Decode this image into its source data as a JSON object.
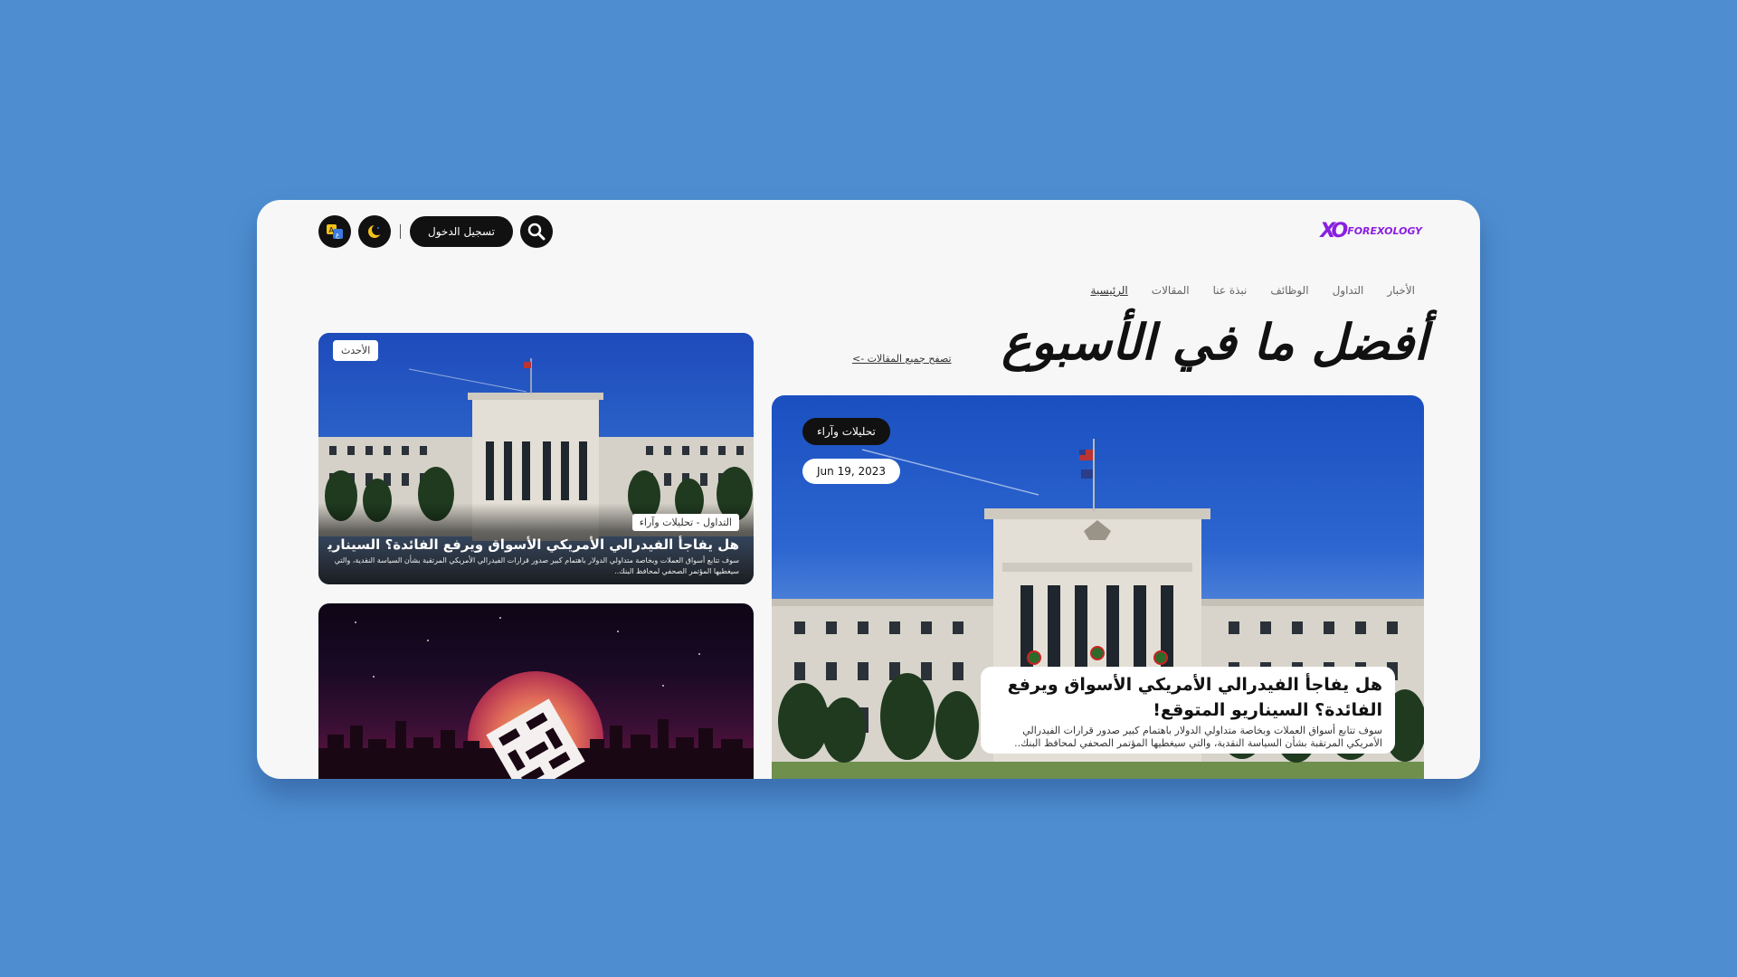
{
  "brand": {
    "mark": "XO",
    "name": "FOREXOLOGY",
    "color": "#8a1fe0"
  },
  "toolbar": {
    "login_label": "تسجيل الدخول",
    "icons": [
      "search-icon",
      "moon-icon",
      "translate-icon"
    ]
  },
  "nav": {
    "items": [
      {
        "label": "الرئيسية",
        "active": true
      },
      {
        "label": "المقالات",
        "active": false
      },
      {
        "label": "نبذة عنا",
        "active": false
      },
      {
        "label": "الوظائف",
        "active": false
      },
      {
        "label": "التداول",
        "active": false
      },
      {
        "label": "الأخبار",
        "active": false
      }
    ]
  },
  "main": {
    "headline": "أفضل ما في الأسبوع",
    "browse_link": "تصفح جميع المقالات ->"
  },
  "feature": {
    "category": "تحليلات وآراء",
    "date": "Jun 19, 2023",
    "title": "هل يفاجأ الفيدرالي الأمريكي الأسواق ويرفع الفائدة؟ السيناريو المتوقع!",
    "excerpt": "سوف تتابع أسواق العملات وبخاصة متداولي الدولار باهتمام كبير صدور قرارات الفيدرالي الأمريكي المرتقبة بشأن السياسة النقدية، والتي سيغطيها المؤتمر الصحفي لمحافظ البنك.."
  },
  "side_cards": [
    {
      "badge": "الأحدث",
      "tag": "التداول - تحليلات وآراء",
      "title": "هل يفاجأ الفيدرالي الأمريكي الأسواق ويرفع الفائدة؟ السيناريو المتوقع!",
      "excerpt": "سوف تتابع أسواق العملات وبخاصة متداولي الدولار باهتمام كبير صدور قرارات الفيدرالي الأمريكي المرتقبة بشأن السياسة النقدية، والتي سيغطيها المؤتمر الصحفي لمحافظ البنك.."
    },
    {
      "image": "cube-logo-over-city-skyline"
    }
  ],
  "colors": {
    "background": "#4e8ed0",
    "window": "#f7f7f7",
    "dark": "#111111",
    "accent": "#8a1fe0"
  }
}
